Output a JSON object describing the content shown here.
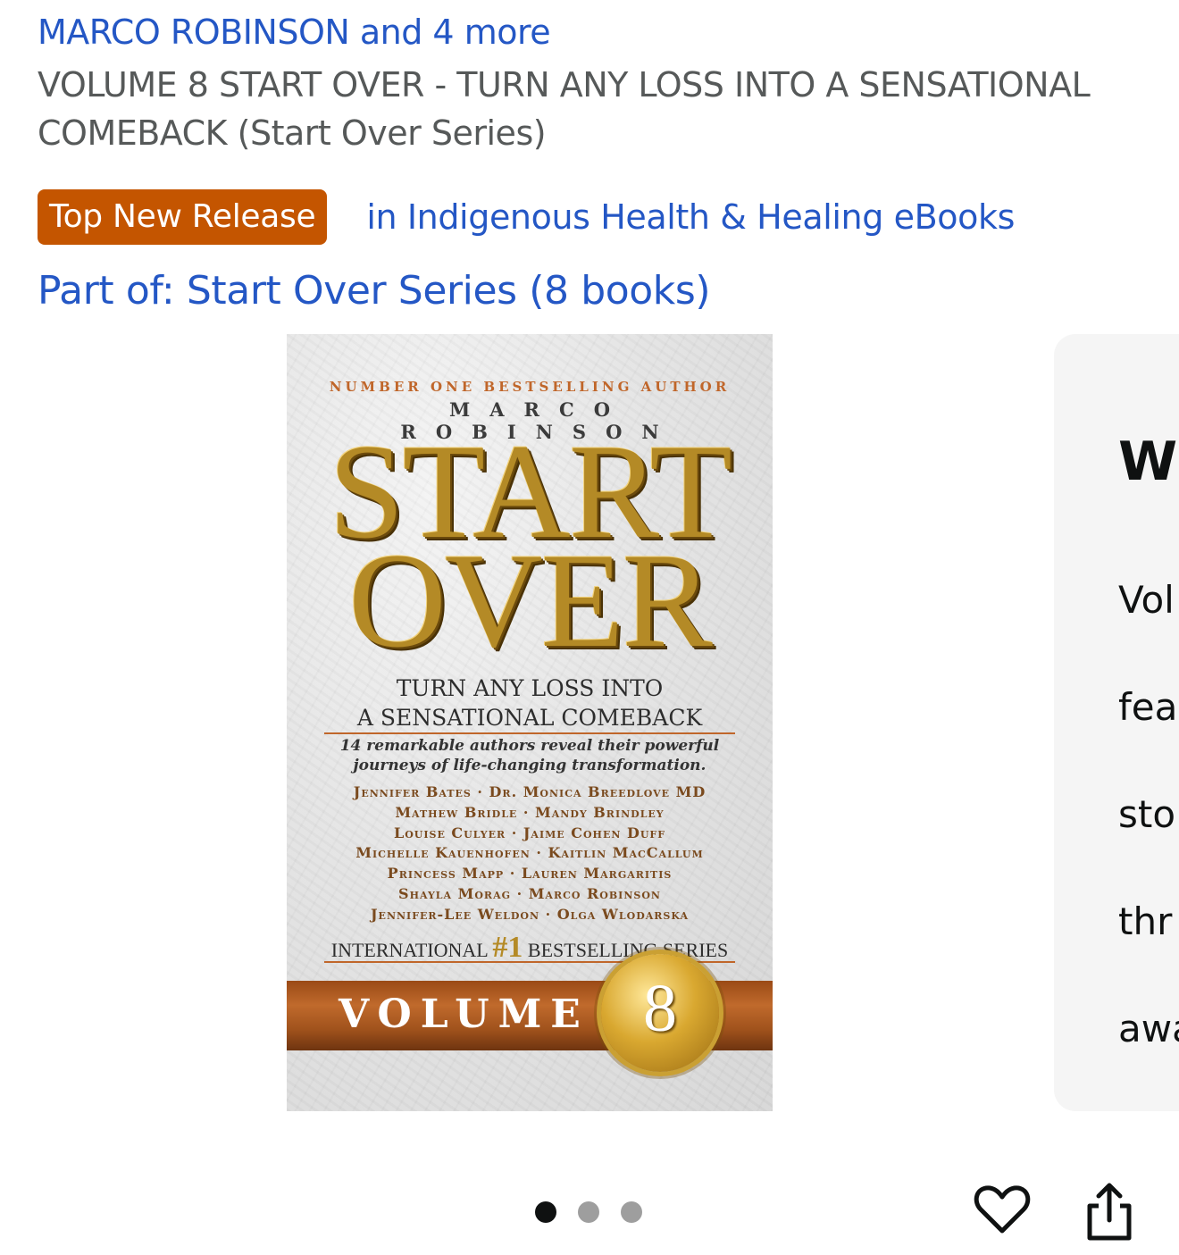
{
  "header": {
    "author_link": "MARCO ROBINSON and 4 more",
    "title": "VOLUME 8 START OVER - TURN ANY LOSS INTO A SENSATIONAL COMEBACK (Start Over Series)"
  },
  "badge": {
    "label": "Top New Release",
    "category": "in Indigenous Health & Healing eBooks",
    "color": "#c45500"
  },
  "series_link": "Part of: Start Over Series (8 books)",
  "cover": {
    "tagline": "NUMBER ONE BESTSELLING AUTHOR",
    "author": "MARCO ROBINSON",
    "title_line1": "START",
    "title_line2": "OVER",
    "subtitle_line1": "TURN ANY LOSS INTO",
    "subtitle_line2": "A SENSATIONAL COMEBACK",
    "description": "14 remarkable authors reveal their powerful journeys of life-changing transformation.",
    "contributors": [
      "Jennifer Bates · Dr. Monica Breedlove MD",
      "Mathew Bridle · Mandy Brindley",
      "Louise Culyer · Jaime Cohen Duff",
      "Michelle Kauenhofen · Kaitlin MacCallum",
      "Princess Mapp · Lauren Margaritis",
      "Shayla Morag · Marco Robinson",
      "Jennifer-Lee Weldon · Olga Wlodarska"
    ],
    "series_prefix": "INTERNATIONAL",
    "series_number": "#1",
    "series_suffix": "BESTSELLING SERIES",
    "volume_label": "VOLUME",
    "volume_number": "8"
  },
  "side_panel": {
    "heading": "Wh",
    "body_lines": [
      "Vol",
      "fea",
      "sto",
      "thr",
      "awa"
    ]
  },
  "carousel": {
    "dot_count": 3,
    "active_index": 0
  },
  "actions": {
    "favorite_icon": "heart-icon",
    "share_icon": "share-icon"
  }
}
